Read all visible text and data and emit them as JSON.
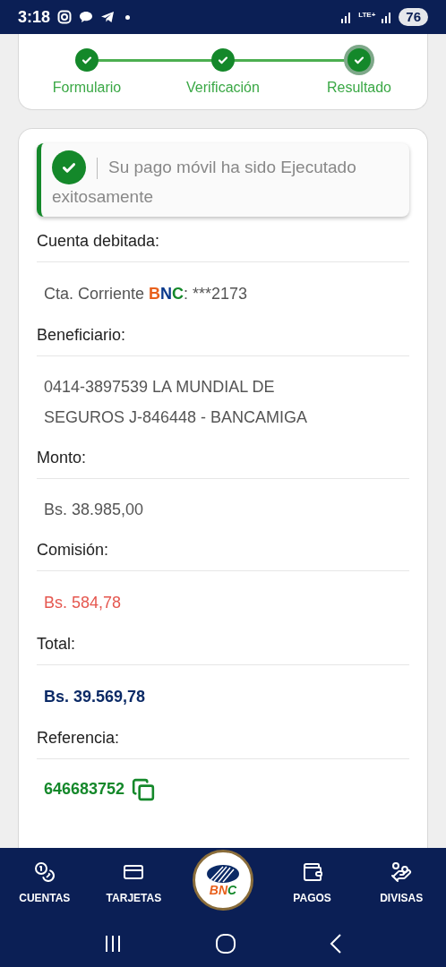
{
  "status_bar": {
    "time": "3:18",
    "network": "LTE+",
    "battery": "76"
  },
  "steps": [
    {
      "label": "Formulario",
      "completed": true,
      "current": false
    },
    {
      "label": "Verificación",
      "completed": true,
      "current": false
    },
    {
      "label": "Resultado",
      "completed": true,
      "current": true
    }
  ],
  "alert": {
    "lines": [
      "Su pago móvil ha sido Ejecutado",
      "exitosamente"
    ]
  },
  "fields": [
    {
      "label": "Cuenta debitada:",
      "kind": "account",
      "prefix": "Cta. Corriente ",
      "brand": [
        {
          "text": "B",
          "color": "#e8601c"
        },
        {
          "text": "N",
          "color": "#0b3a8c"
        },
        {
          "text": "C",
          "color": "#14882a"
        }
      ],
      "suffix": ": ***2173"
    },
    {
      "label": "Beneficiario:",
      "kind": "plain",
      "value": "0414-3897539 LA MUNDIAL DE SEGUROS J-846448 - BANCAMIGA"
    },
    {
      "label": "Monto:",
      "kind": "plain",
      "value": "Bs. 38.985,00"
    },
    {
      "label": "Comisión:",
      "kind": "fee",
      "value": "Bs. 584,78"
    },
    {
      "label": "Total:",
      "kind": "total",
      "value": "Bs. 39.569,78"
    },
    {
      "label": "Referencia:",
      "kind": "reference",
      "value": "646683752"
    }
  ],
  "bottom_nav": [
    {
      "label": "CUENTAS",
      "kind": "coins"
    },
    {
      "label": "TARJETAS",
      "kind": "card"
    },
    {
      "label": "PAGOS",
      "kind": "payment"
    },
    {
      "label": "DIVISAS",
      "kind": "dollar"
    }
  ],
  "logo": {
    "letters": [
      {
        "text": "B",
        "color": "#e8601c"
      },
      {
        "text": "N",
        "color": "#e8601c"
      },
      {
        "text": "C",
        "color": "#14882a"
      }
    ]
  }
}
